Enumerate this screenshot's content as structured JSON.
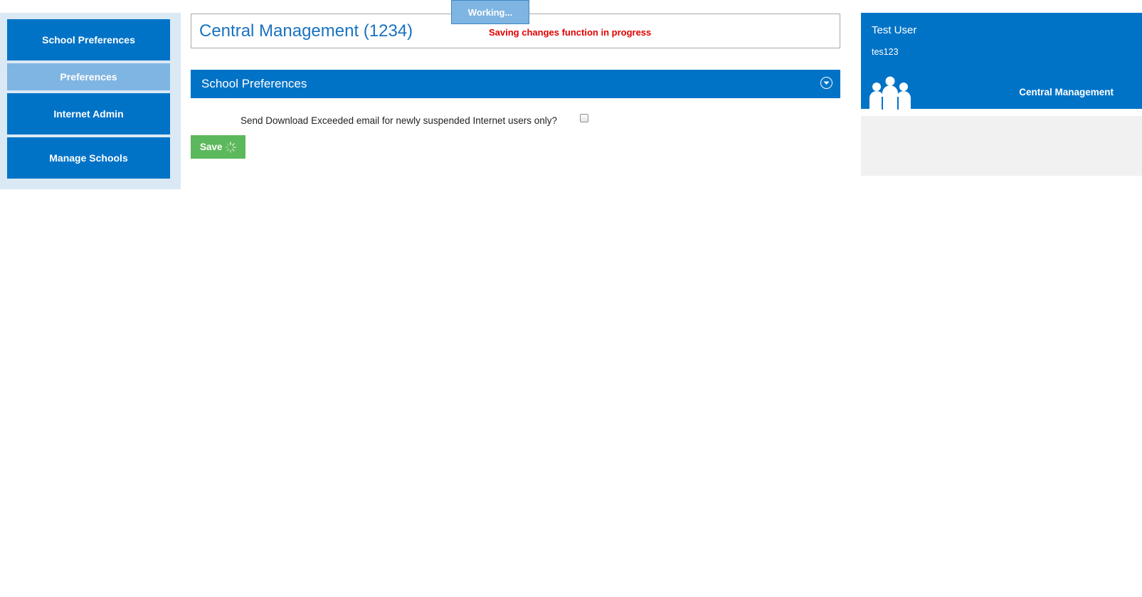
{
  "sidebar": {
    "items": [
      {
        "label": "School Preferences"
      },
      {
        "label": "Preferences"
      },
      {
        "label": "Internet Admin"
      },
      {
        "label": "Manage Schools"
      }
    ]
  },
  "header": {
    "title": "Central Management (1234)",
    "status_message": "Saving changes function in progress"
  },
  "working_popup": {
    "label": "Working..."
  },
  "section": {
    "title": "School Preferences",
    "collapse_icon": "chevron-down-circle-icon"
  },
  "preferences": {
    "download_exceeded_label": "Send Download Exceeded email for newly suspended Internet users only?",
    "download_exceeded_checked": false
  },
  "actions": {
    "save_label": "Save",
    "spinner_icon": "loading-spinner-icon"
  },
  "user_panel": {
    "name": "Test User",
    "username": "tes123",
    "icon": "users-group-icon",
    "label": "Central Management"
  },
  "colors": {
    "primary": "#0173c7",
    "sub_nav": "#7fb5e2",
    "save_button": "#5cb85c",
    "status_text": "#e00000",
    "title_text": "#1a72c0"
  }
}
